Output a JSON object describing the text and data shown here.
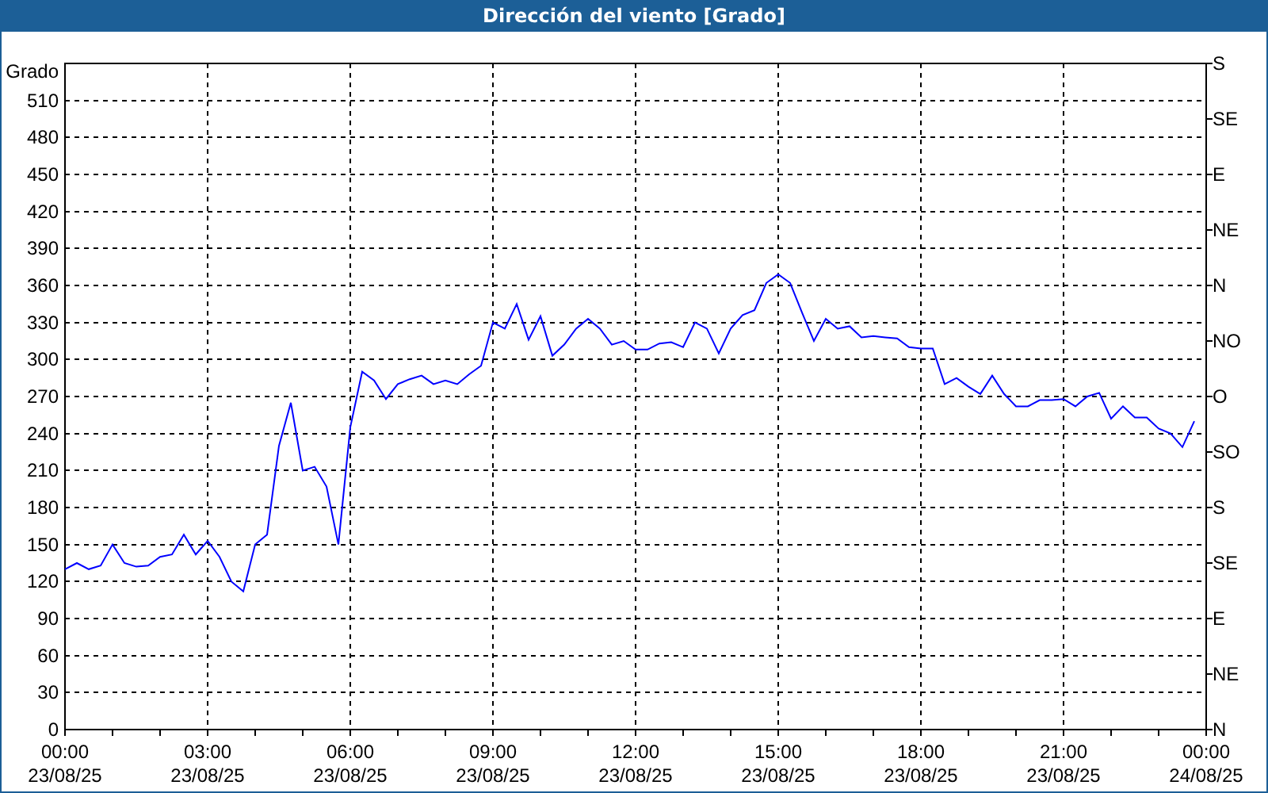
{
  "chart": {
    "chart_data": {
      "type": "line",
      "title": "Dirección del viento [Grado]",
      "ylabel": "Grado",
      "grid": true,
      "ylim": [
        0,
        540
      ],
      "yticks": [
        0,
        30,
        60,
        90,
        120,
        150,
        180,
        210,
        240,
        270,
        300,
        330,
        360,
        390,
        420,
        450,
        480,
        510
      ],
      "categories": [
        "00:00\n23/08/25",
        null,
        null,
        null,
        null,
        null,
        null,
        null,
        null,
        null,
        null,
        null,
        "03:00\n23/08/25",
        null,
        null,
        null,
        null,
        null,
        null,
        null,
        null,
        null,
        null,
        null,
        "06:00\n23/08/25",
        null,
        null,
        null,
        null,
        null,
        null,
        null,
        null,
        null,
        null,
        null,
        "09:00\n23/08/25",
        null,
        null,
        null,
        null,
        null,
        null,
        null,
        null,
        null,
        null,
        null,
        "12:00\n23/08/25",
        null,
        null,
        null,
        null,
        null,
        null,
        null,
        null,
        null,
        null,
        null,
        "15:00\n23/08/25",
        null,
        null,
        null,
        null,
        null,
        null,
        null,
        null,
        null,
        null,
        null,
        "18:00\n23/08/25",
        null,
        null,
        null,
        null,
        null,
        null,
        null,
        null,
        null,
        null,
        null,
        "21:00\n23/08/25",
        null,
        null,
        null,
        null,
        null,
        null,
        null,
        null,
        null,
        null,
        null,
        "00:00\n24/08/25"
      ],
      "series": [
        {
          "color": "#0000ff",
          "values": [
            130,
            135,
            130,
            133,
            150,
            135,
            132,
            133,
            140,
            142,
            158,
            142,
            153,
            140,
            120,
            112,
            150,
            158,
            230,
            265,
            210,
            213,
            197,
            150,
            245,
            290,
            283,
            268,
            280,
            284,
            287,
            280,
            283,
            280,
            288,
            295,
            330,
            325,
            345,
            316,
            335,
            303,
            312,
            325,
            333,
            325,
            312,
            315,
            308,
            308,
            313,
            314,
            310,
            330,
            325,
            305,
            325,
            336,
            340,
            362,
            369,
            362,
            338,
            315,
            333,
            325,
            327,
            318,
            319,
            318,
            317,
            310,
            309,
            309,
            280,
            285,
            278,
            272,
            287,
            272,
            262,
            262,
            267,
            267,
            268,
            262,
            270,
            273,
            252,
            262,
            253,
            253,
            244,
            240,
            229,
            250,
            null
          ]
        }
      ]
    },
    "compass_axis": [
      "S",
      "SE",
      "E",
      "NE",
      "N",
      "NO",
      "O",
      "SO",
      "S",
      "SE",
      "E",
      "NE",
      "N"
    ]
  }
}
